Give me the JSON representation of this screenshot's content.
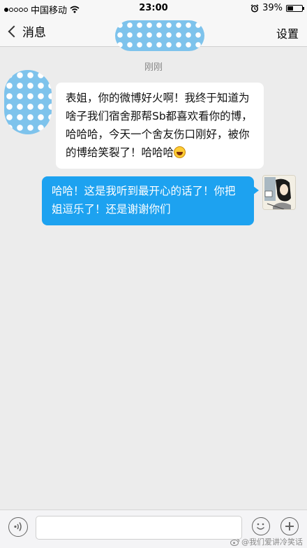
{
  "status_bar": {
    "carrier": "中国移动",
    "time": "23:00",
    "battery_percent": "39%",
    "battery_level": 0.39
  },
  "nav": {
    "back_label": "消息",
    "settings_label": "设置"
  },
  "chat": {
    "timestamp": "刚刚",
    "messages": [
      {
        "sender": "contact",
        "text": "表姐，你的微博好火啊！我终于知道为啥子我们宿舍那帮Sb都喜欢看你的博，哈哈哈，今天一个舍友伤口刚好，被你的博给笑裂了！哈哈哈",
        "emoji": "laughing-emoji"
      },
      {
        "sender": "self",
        "text": "哈哈！这是我听到最开心的话了！你把姐逗乐了！还是谢谢你们"
      }
    ]
  },
  "input_bar": {
    "placeholder": "",
    "icons": [
      "voice-icon",
      "emoji-face-icon",
      "plus-icon"
    ]
  },
  "watermark": {
    "text": "@我们爱讲冷笑话"
  },
  "colors": {
    "background": "#ececec",
    "self_bubble": "#1da2f0",
    "contact_bubble": "#ffffff",
    "mask": "#7ec3ec"
  }
}
